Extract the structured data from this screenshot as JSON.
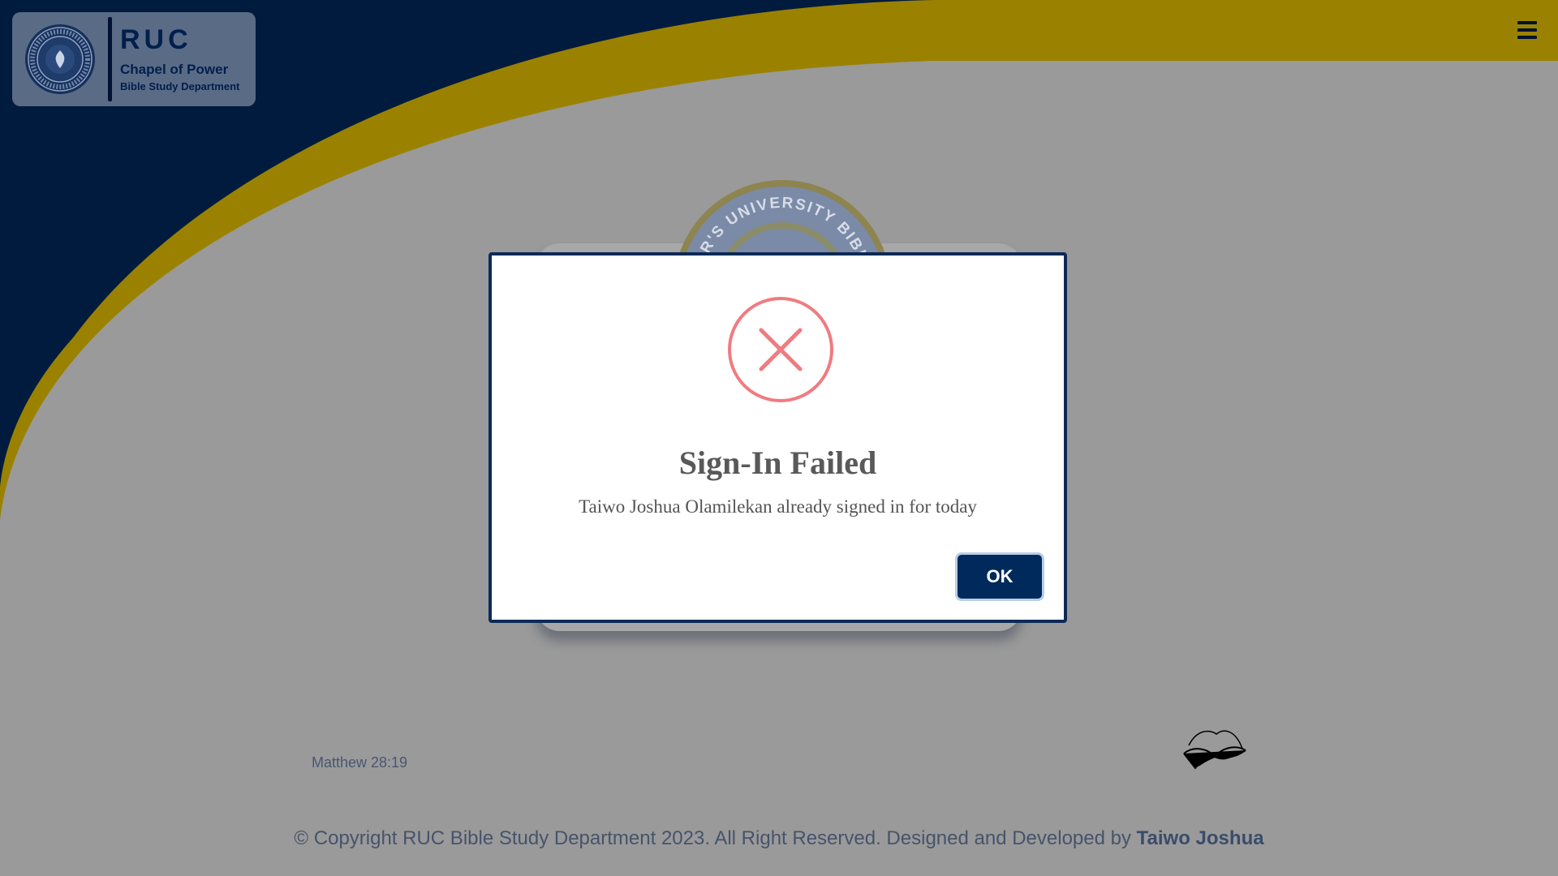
{
  "header": {
    "logo_title": "RUC",
    "logo_subtitle": "Chapel of Power",
    "logo_department": "Bible Study Department",
    "logo_seal_text": "REDEEMER'S UNIVERSITY BIBLE STUDY",
    "menu_icon": "hamburger-icon"
  },
  "background": {
    "seal_text": "REDEEMER'S UNIVERSITY BIBLE STUDY",
    "verse_reference": "Matthew 28:19",
    "bible_icon": "open-bible-icon"
  },
  "modal": {
    "icon": "error-x-icon",
    "title": "Sign-In Failed",
    "message": "Taiwo Joshua Olamilekan already signed in for today",
    "ok_label": "OK"
  },
  "footer": {
    "copyright": "© Copyright RUC Bible Study Department 2023. All Right Reserved. Designed and Developed by",
    "author": "Taiwo Joshua"
  },
  "colors": {
    "navy": "#001b3d",
    "gold": "#9a8200",
    "overlay_gray": "#9a9a9a",
    "error_red": "#f07b80",
    "button_blue": "#002a5c"
  }
}
